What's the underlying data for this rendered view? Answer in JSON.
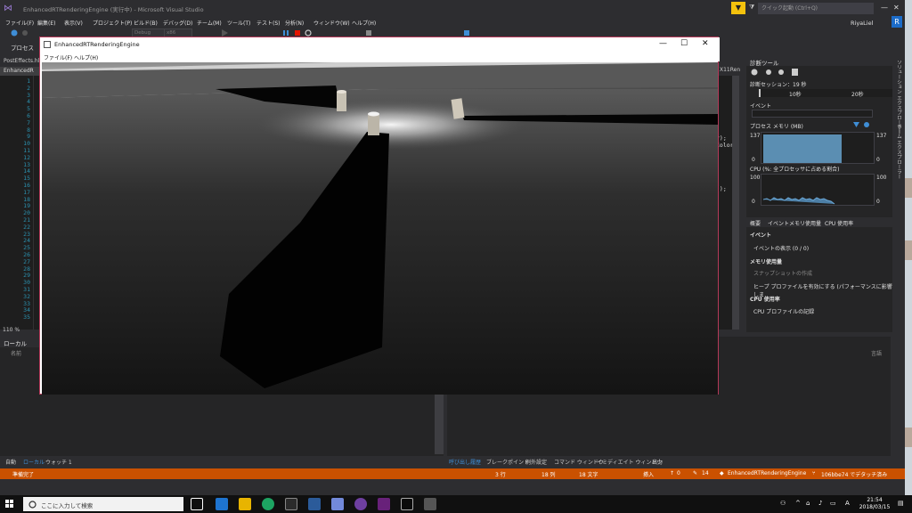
{
  "vs": {
    "window_title": "EnhancedRTRenderingEngine (実行中) - Microsoft Visual Studio",
    "quick_launch": "クイック起動 (Ctrl+Q)",
    "user_name": "RiyaLiel",
    "user_initial": "R",
    "menu": [
      "ファイル(F)",
      "編集(E)",
      "表示(V)",
      "プロジェクト(P)",
      "ビルド(B)",
      "デバッグ(D)",
      "チーム(M)",
      "ツール(T)",
      "テスト(S)",
      "分析(N)",
      "ウィンドウ(W)",
      "ヘルプ(H)"
    ],
    "toolbar": {
      "config": "Debug",
      "platform": "x86"
    },
    "process_label": "プロセス",
    "tabs": {
      "file_tab": "PostEffects.hl",
      "project_tab": "EnhancedR",
      "right_code_tab": "X11Ren"
    },
    "line_numbers": [
      "1",
      "2",
      "3",
      "4",
      "5",
      "6",
      "7",
      "8",
      "9",
      "10",
      "11",
      "12",
      "13",
      "14",
      "15",
      "16",
      "17",
      "18",
      "19",
      "20",
      "21",
      "22",
      "23",
      "24",
      "25",
      "26",
      "27",
      "28",
      "29",
      "30",
      "31",
      "32",
      "33",
      "34",
      "35"
    ],
    "code_fragments": [
      "r);",
      "Color",
      "));"
    ],
    "zoom": "110 %"
  },
  "locals": {
    "title": "ローカル",
    "column_name": "名前",
    "tabs": [
      "自動",
      "ローカル",
      "ウォッチ 1"
    ]
  },
  "output": {
    "tabs": [
      "呼び出し履歴",
      "ブレークポイント",
      "例外設定",
      "コマンド ウィンドウ",
      "イミディエイト ウィンドウ",
      "出力"
    ],
    "right_header": "言語"
  },
  "diag": {
    "title": "診断ツール",
    "session": "診断セッション：19 秒",
    "ticks": [
      "10秒",
      "20秒"
    ],
    "events_label": "イベント",
    "memory_label": "プロセス メモリ (MB)",
    "memory_max": "137",
    "memory_min": "0",
    "cpu_label": "CPU (%: 全プロセッサに占める割合)",
    "cpu_max": "100",
    "cpu_min": "0",
    "tabs": [
      "概要",
      "イベント",
      "メモリ使用量",
      "CPU 使用率"
    ],
    "section_events": "イベント",
    "show_events": "イベントの表示 (0 / 0)",
    "section_memory": "メモリ使用量",
    "snapshot": "スナップショットの作成",
    "heap_profile": "ヒープ プロファイルを有効にする (パフォーマンスに影響しま",
    "section_cpu": "CPU 使用率",
    "cpu_profile": "CPU プロファイルの記録",
    "side_tabs": [
      "ソリューション エクスプローラー",
      "チーム エクスプローラー"
    ]
  },
  "status": {
    "ready": "準備完了",
    "line": "3 行",
    "col": "18 列",
    "chars": "18 文字",
    "mode": "挿入",
    "up": "0",
    "pencil": "14",
    "project": "EnhancedRTRenderingEngine",
    "branch": "106bbe74 でデタッチ済み"
  },
  "app": {
    "title": "EnhancedRTRenderingEngine",
    "menu": [
      "ファイル(F)",
      "ヘルプ(H)"
    ]
  },
  "taskbar": {
    "search_placeholder": "ここに入力して検索",
    "time": "21:54",
    "date": "2018/03/15",
    "ime": "A"
  }
}
